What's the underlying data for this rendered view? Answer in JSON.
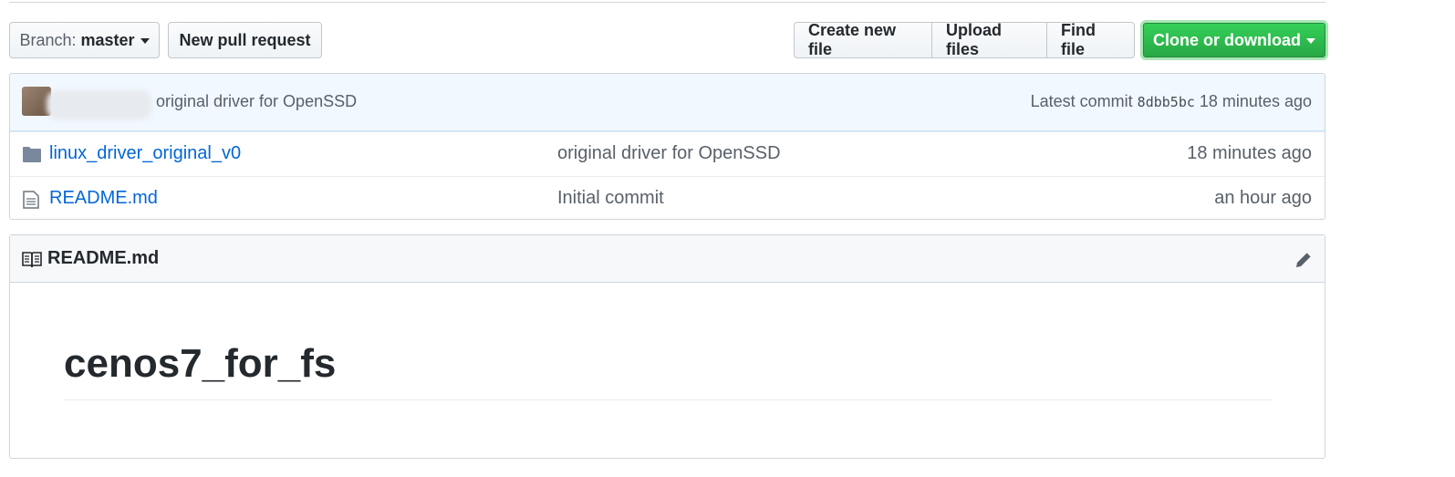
{
  "toolbar": {
    "branch_prefix": "Branch:",
    "branch_name": "master",
    "new_pull_request": "New pull request",
    "create_new_file": "Create new file",
    "upload_files": "Upload files",
    "find_file": "Find file",
    "clone_or_download": "Clone or download"
  },
  "commit": {
    "message": "original driver for OpenSSD",
    "latest_label": "Latest commit",
    "sha": "8dbb5bc",
    "age": "18 minutes ago"
  },
  "files": [
    {
      "type": "folder",
      "name": "linux_driver_original_v0",
      "message": "original driver for OpenSSD",
      "age": "18 minutes ago"
    },
    {
      "type": "file",
      "name": "README.md",
      "message": "Initial commit",
      "age": "an hour ago"
    }
  ],
  "readme": {
    "filename": "README.md",
    "heading": "cenos7_for_fs"
  },
  "colors": {
    "link": "#0366d6",
    "clone_green": "#28a745",
    "commit_bar_bg": "#f1f8ff"
  },
  "icons": {
    "branch_caret": "caret-down-icon",
    "folder": "folder-icon",
    "file": "file-text-icon",
    "book": "book-icon",
    "edit": "pencil-icon"
  }
}
